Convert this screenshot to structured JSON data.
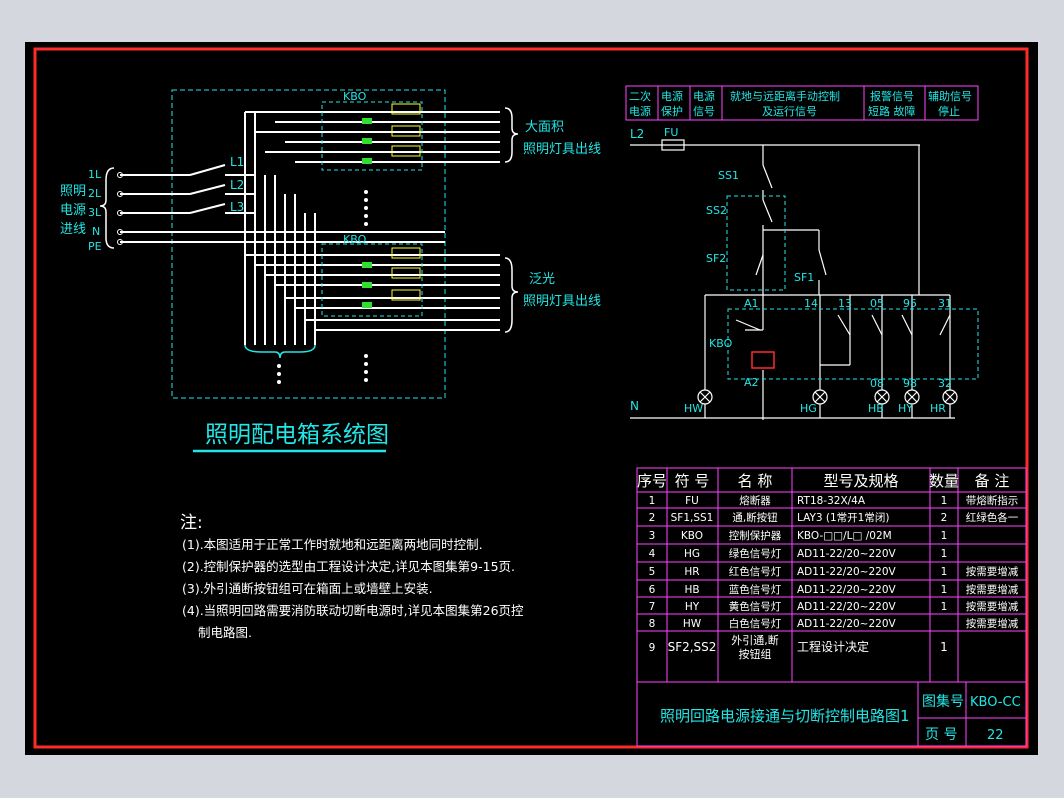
{
  "left": {
    "title": "照明配电箱系统图",
    "kbo_top": "KBO",
    "kbo_bottom": "KBO",
    "phase_labels": [
      "L1",
      "L2",
      "L3"
    ],
    "source_terminals": [
      "1L",
      "2L",
      "3L",
      "N",
      "PE"
    ],
    "source_label": [
      "照明",
      "电源",
      "进线"
    ],
    "out_top": [
      "大面积",
      "照明灯具出线"
    ],
    "out_bottom": [
      "泛光",
      "照明灯具出线"
    ]
  },
  "notes": {
    "heading": "注:",
    "lines": [
      "(1).本图适用于正常工作时就地和远距离两地同时控制.",
      "(2).控制保护器的选型由工程设计决定,详见本图集第9-15页.",
      "(3).外引通断按钮组可在箱面上或墙壁上安装.",
      "(4).当照明回路需要消防联动切断电源时,详见本图集第26页控",
      "制电路图."
    ]
  },
  "circuit": {
    "header_cells": [
      [
        "二次",
        "电源"
      ],
      [
        "电源",
        "保护"
      ],
      [
        "电源",
        "信号"
      ],
      [
        "就地与远距离手动控制",
        "及运行信号"
      ],
      [
        "报警信号",
        "短路 故障"
      ],
      [
        "辅助信号",
        "停止"
      ]
    ],
    "l2": "L2",
    "fu": "FU",
    "n": "N",
    "ss1": "SS1",
    "ss2": "SS2",
    "sf2": "SF2",
    "sf1": "SF1",
    "kbo": "KBO",
    "nodes_top": [
      "A1",
      "14",
      "13",
      "05",
      "95",
      "31"
    ],
    "a2": "A2",
    "nodes_bottom": [
      "08",
      "98",
      "32"
    ],
    "lamps": [
      "HW",
      "HG",
      "HB",
      "HY",
      "HR"
    ]
  },
  "bom": {
    "headers": [
      "序号",
      "符 号",
      "名 称",
      "型号及规格",
      "数量",
      "备 注"
    ],
    "rows": [
      [
        "1",
        "FU",
        "熔断器",
        "RT18-32X/4A",
        "1",
        "带熔断指示"
      ],
      [
        "2",
        "SF1,SS1",
        "通,断按钮",
        "LAY3  (1常开1常闭)",
        "2",
        "红绿色各一"
      ],
      [
        "3",
        "KBO",
        "控制保护器",
        "KBO-□□/L□ /02M",
        "1",
        ""
      ],
      [
        "4",
        "HG",
        "绿色信号灯",
        "AD11-22/20~220V",
        "1",
        ""
      ],
      [
        "5",
        "HR",
        "红色信号灯",
        "AD11-22/20~220V",
        "1",
        "按需要增减"
      ],
      [
        "6",
        "HB",
        "蓝色信号灯",
        "AD11-22/20~220V",
        "1",
        "按需要增减"
      ],
      [
        "7",
        "HY",
        "黄色信号灯",
        "AD11-22/20~220V",
        "1",
        "按需要增减"
      ],
      [
        "8",
        "HW",
        "白色信号灯",
        "AD11-22/20~220V",
        "",
        "按需要增减"
      ],
      [
        "9",
        "SF2,SS2",
        "外引通,断按钮组",
        "工程设计决定",
        "1",
        ""
      ]
    ]
  },
  "titleblock": {
    "drawing_title": "照明回路电源接通与切断控制电路图1",
    "atlas_label": "图集号",
    "atlas_value": "KBO-CC",
    "page_label": "页 号",
    "page_value": "22"
  },
  "colors": {
    "background": "#000000",
    "frame": "#ff2a2a",
    "line": "#ffffff",
    "text": "#22e6e6",
    "table": "#ff44ff",
    "dashed": "#22e6e6",
    "breaker": "#33dd33",
    "terminal": "#ffff33"
  }
}
